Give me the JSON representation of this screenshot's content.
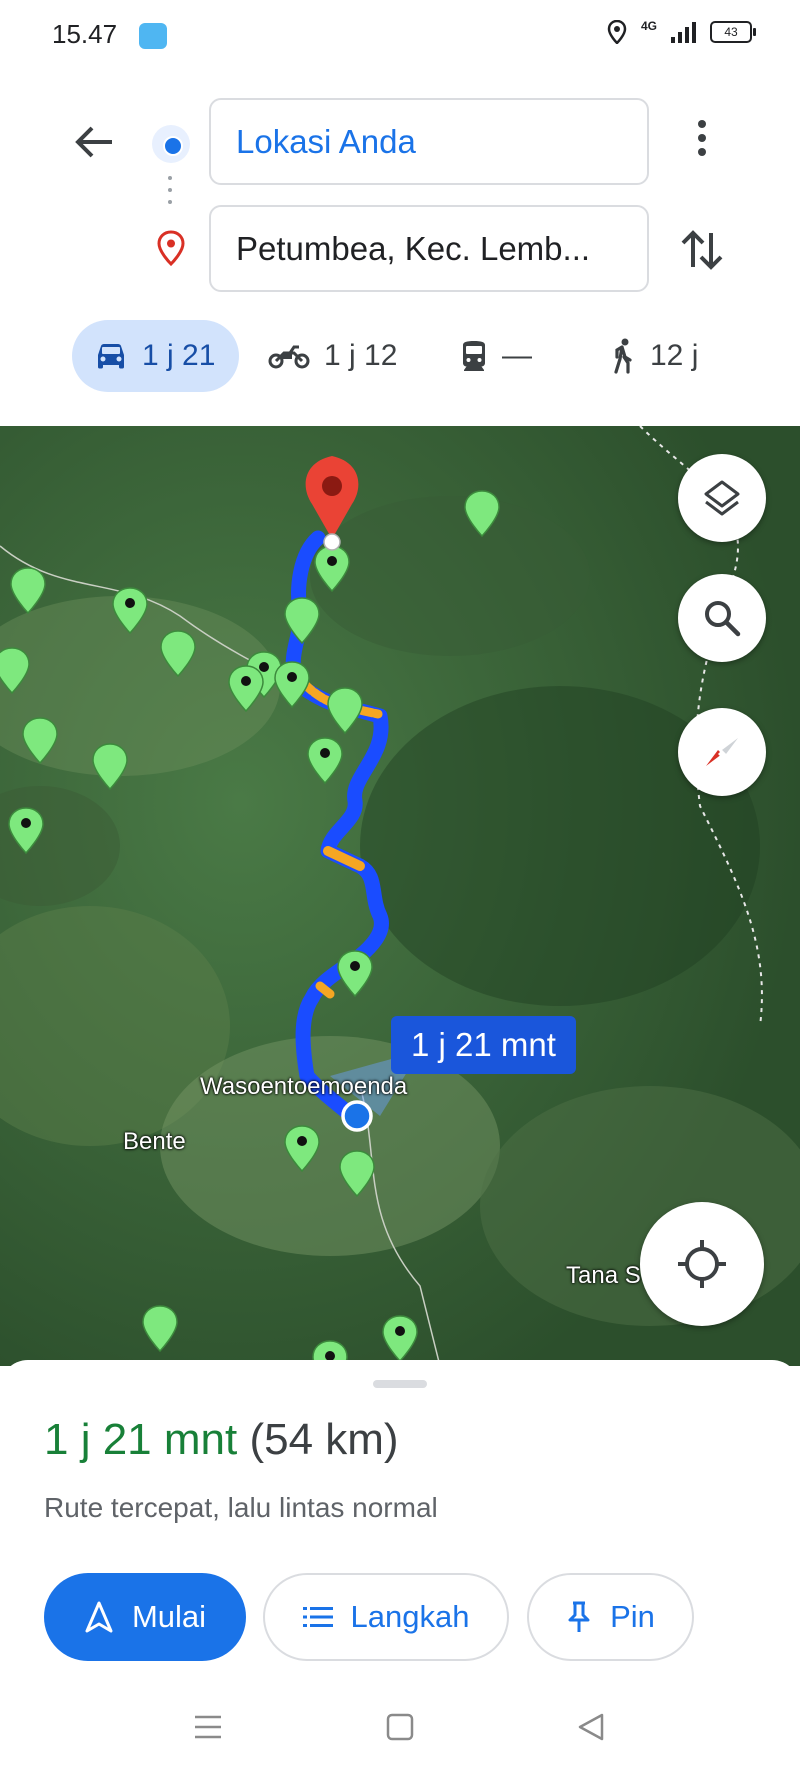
{
  "status_bar": {
    "time": "15.47",
    "network": "4G",
    "battery": "43"
  },
  "directions": {
    "origin": "Lokasi Anda",
    "destination": "Petumbea, Kec. Lemb..."
  },
  "travel_modes": [
    {
      "mode": "car-icon",
      "label": "1 j 21",
      "selected": true
    },
    {
      "mode": "motorcycle-icon",
      "label": "1 j 12",
      "selected": false
    },
    {
      "mode": "transit-icon",
      "label": "—",
      "selected": false
    },
    {
      "mode": "walk-icon",
      "label": "12 j",
      "selected": false
    }
  ],
  "map": {
    "labels": {
      "wasoentoemoenda": "Wasoentoemoenda",
      "bente": "Bente",
      "tana": "Tana S"
    },
    "route_badge": "1 j 21 mnt",
    "colors": {
      "route": "#1a4cff",
      "traffic_slow": "#f5a623",
      "destination_pin": "#ea4335",
      "place_marker": "#7ee87e"
    }
  },
  "route_summary": {
    "duration": "1 j 21 mnt",
    "distance": "(54 km)",
    "description": "Rute tercepat, lalu lintas normal"
  },
  "actions": {
    "start": "Mulai",
    "steps": "Langkah",
    "pin": "Pin"
  },
  "colors": {
    "accent": "#1a73e8",
    "duration_green": "#188038"
  }
}
